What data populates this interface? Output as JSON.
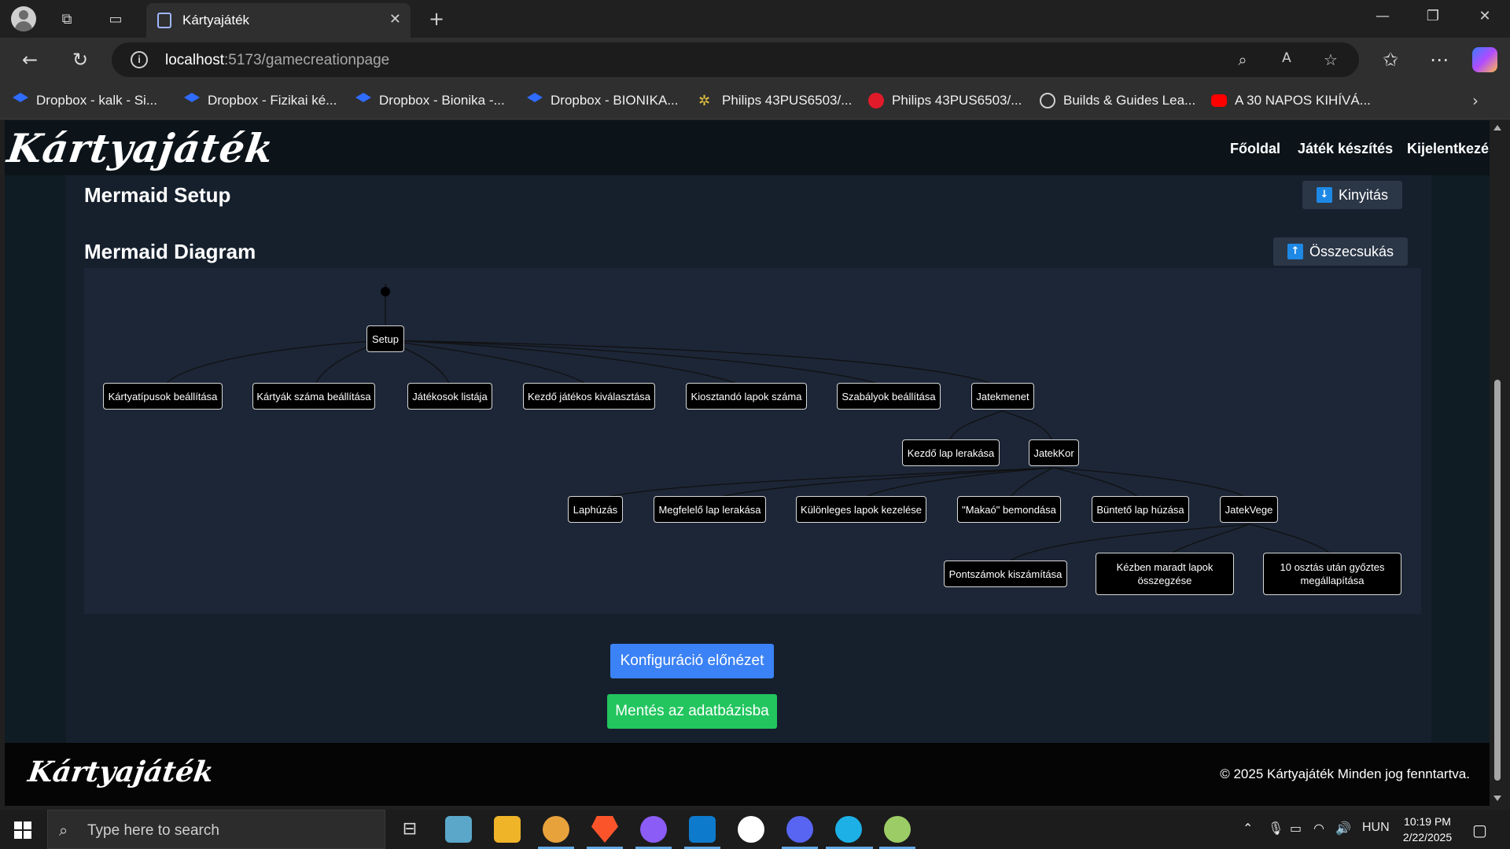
{
  "browser": {
    "tab_title": "Kártyajáték",
    "url_host": "localhost",
    "url_path": ":5173/gamecreationpage",
    "bookmarks": [
      {
        "label": "Dropbox - kalk - Si...",
        "icon": "dropbox-icon"
      },
      {
        "label": "Dropbox - Fizikai ké...",
        "icon": "dropbox-icon"
      },
      {
        "label": "Dropbox - Bionika -...",
        "icon": "dropbox-icon"
      },
      {
        "label": "Dropbox - BIONIKA...",
        "icon": "dropbox-icon"
      },
      {
        "label": "Philips 43PUS6503/...",
        "icon": "star-icon"
      },
      {
        "label": "Philips 43PUS6503/...",
        "icon": "red-circle-icon"
      },
      {
        "label": "Builds & Guides Lea...",
        "icon": "globe-icon"
      },
      {
        "label": "A 30 NAPOS KIHÍVÁ...",
        "icon": "youtube-icon"
      }
    ]
  },
  "site": {
    "logo": "Kártyajáték",
    "nav": [
      "Főoldal",
      "Játék készítés",
      "Kijelentkezés"
    ],
    "footer_logo": "Kártyajáték",
    "copyright": "© 2025 Kártyajáték Minden jog fenntartva."
  },
  "sections": {
    "setup_title": "Mermaid Setup",
    "setup_toggle": "Kinyitás",
    "diagram_title": "Mermaid Diagram",
    "diagram_toggle": "Összecsukás"
  },
  "diagram": {
    "nodes": {
      "setup": "Setup",
      "kartyatipusok": "Kártyatípusok beállítása",
      "kartyak_szama": "Kártyák száma beállítása",
      "jatekosok": "Játékosok listája",
      "kezdo_jatekos": "Kezdő játékos kiválasztása",
      "kiosztando": "Kiosztandó lapok száma",
      "szabalyok": "Szabályok beállítása",
      "jatekmenet": "Jatekmenet",
      "kezdo_lap": "Kezdő lap lerakása",
      "jatekkor": "JatekKor",
      "laphuzas": "Laphúzás",
      "megfelelo_lap": "Megfelelő lap lerakása",
      "kulonleges": "Különleges lapok kezelése",
      "makao": "\"Makaó\" bemondása",
      "bunteto": "Büntető lap húzása",
      "jatekvege": "JatekVege",
      "pontszamok": "Pontszámok kiszámítása",
      "kezben_maradt": "Kézben maradt lapok összegzése",
      "tiz_osztas": "10 osztás után győztes megállapítása"
    }
  },
  "actions": {
    "preview": "Konfiguráció előnézet",
    "save": "Mentés az adatbázisba"
  },
  "taskbar": {
    "search_placeholder": "Type here to search",
    "language": "HUN",
    "time": "10:19 PM",
    "date": "2/22/2025"
  },
  "colors": {
    "primary_button": "#3b82f6",
    "success_button": "#22c55e",
    "page_bg": "#0f1c24",
    "panel_bg": "#16202d",
    "diagram_bg": "#1c2637"
  }
}
